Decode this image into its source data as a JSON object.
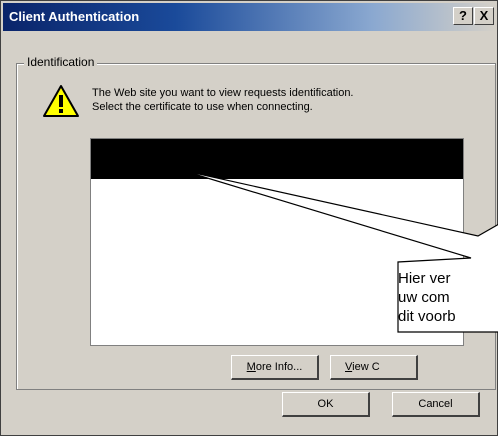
{
  "window": {
    "title": "Client Authentication",
    "help_button": "?",
    "close_button": "X"
  },
  "identification": {
    "group_label": "Identification",
    "message_line1": "The Web site you want to view requests identification.",
    "message_line2": "Select the certificate to use when connecting.",
    "warning_icon": "warning-triangle-icon"
  },
  "buttons": {
    "more_info_prefix": "M",
    "more_info_rest": "ore Info...",
    "view_prefix": "V",
    "view_rest": "iew C",
    "ok": "OK",
    "cancel": "Cancel"
  },
  "callout": {
    "line1": "Hier ver",
    "line2": "uw com",
    "line3": "dit voorb"
  },
  "colors": {
    "titlebar_start": "#0a246a",
    "dialog_face": "#d4d0c8",
    "selection": "#000000"
  }
}
